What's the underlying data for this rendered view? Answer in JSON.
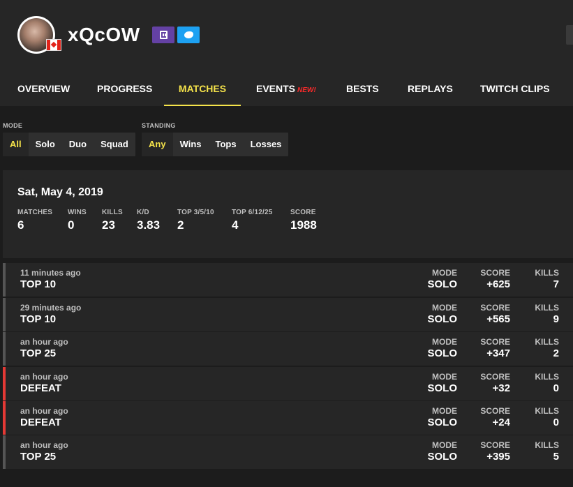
{
  "profile": {
    "name": "xQcOW",
    "avatar_icon": "avatar-image",
    "flag_icon": "canada-flag-icon",
    "social": [
      "twitch-icon",
      "twitter-icon"
    ],
    "colors": {
      "twitch": "#6441a4",
      "twitter": "#1da1f2",
      "accent": "#f5e34a",
      "defeat": "#e53935"
    }
  },
  "tabs": [
    {
      "label": "OVERVIEW"
    },
    {
      "label": "PROGRESS"
    },
    {
      "label": "MATCHES",
      "active": true
    },
    {
      "label": "EVENTS",
      "badge": "NEW!"
    },
    {
      "label": "BESTS"
    },
    {
      "label": "REPLAYS"
    },
    {
      "label": "TWITCH CLIPS"
    }
  ],
  "filters": {
    "mode": {
      "label": "MODE",
      "options": [
        "All",
        "Solo",
        "Duo",
        "Squad"
      ],
      "selected": "All"
    },
    "standing": {
      "label": "STANDING",
      "options": [
        "Any",
        "Wins",
        "Tops",
        "Losses"
      ],
      "selected": "Any"
    }
  },
  "summary": {
    "date": "Sat, May 4, 2019",
    "stats": [
      {
        "label": "MATCHES",
        "value": "6"
      },
      {
        "label": "WINS",
        "value": "0"
      },
      {
        "label": "KILLS",
        "value": "23"
      },
      {
        "label": "K/D",
        "value": "3.83"
      },
      {
        "label": "TOP 3/5/10",
        "value": "2"
      },
      {
        "label": "TOP 6/12/25",
        "value": "4"
      },
      {
        "label": "SCORE",
        "value": "1988"
      }
    ]
  },
  "match_labels": {
    "mode": "MODE",
    "score": "SCORE",
    "kills": "KILLS"
  },
  "matches": [
    {
      "time": "11 minutes ago",
      "place": "TOP 10",
      "mode": "SOLO",
      "score": "+625",
      "kills": "7",
      "result": "top"
    },
    {
      "time": "29 minutes ago",
      "place": "TOP 10",
      "mode": "SOLO",
      "score": "+565",
      "kills": "9",
      "result": "top"
    },
    {
      "time": "an hour ago",
      "place": "TOP 25",
      "mode": "SOLO",
      "score": "+347",
      "kills": "2",
      "result": "top"
    },
    {
      "time": "an hour ago",
      "place": "DEFEAT",
      "mode": "SOLO",
      "score": "+32",
      "kills": "0",
      "result": "defeat"
    },
    {
      "time": "an hour ago",
      "place": "DEFEAT",
      "mode": "SOLO",
      "score": "+24",
      "kills": "0",
      "result": "defeat"
    },
    {
      "time": "an hour ago",
      "place": "TOP 25",
      "mode": "SOLO",
      "score": "+395",
      "kills": "5",
      "result": "top"
    }
  ]
}
